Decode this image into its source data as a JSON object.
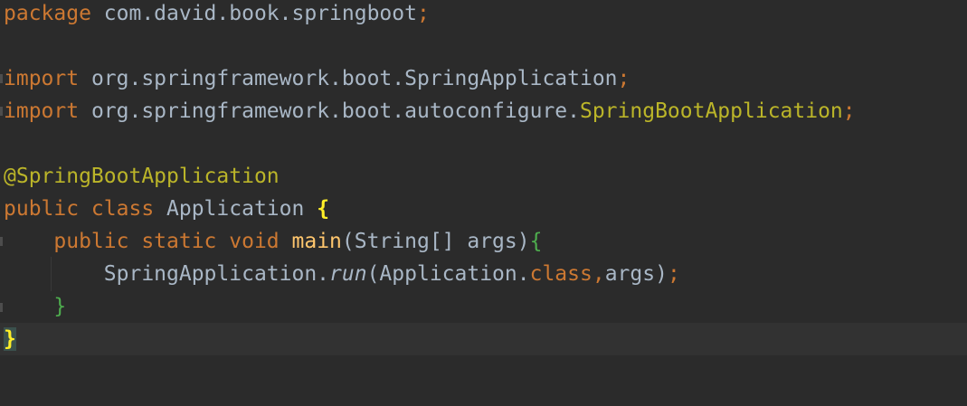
{
  "editor": {
    "colors": {
      "background": "#2b2b2b",
      "current_line": "#323232",
      "keyword": "#cc7832",
      "annotation": "#bbb529",
      "method": "#ffc66d",
      "plain": "#a9b7c6",
      "brace_match": "#ffef28"
    },
    "lines": [
      {
        "tokens": [
          {
            "text": "package",
            "type": "keyword"
          },
          {
            "text": " com.david.book.springboot",
            "type": "plain"
          },
          {
            "text": ";",
            "type": "keyword"
          }
        ]
      },
      {
        "tokens": []
      },
      {
        "tokens": [
          {
            "text": "import",
            "type": "keyword"
          },
          {
            "text": " org.springframework.boot.SpringApplication",
            "type": "plain"
          },
          {
            "text": ";",
            "type": "keyword"
          }
        ]
      },
      {
        "tokens": [
          {
            "text": "import",
            "type": "keyword"
          },
          {
            "text": " org.springframework.boot.autoconfigure.",
            "type": "plain"
          },
          {
            "text": "SpringBootApplication",
            "type": "annotation"
          },
          {
            "text": ";",
            "type": "keyword"
          }
        ]
      },
      {
        "tokens": []
      },
      {
        "tokens": [
          {
            "text": "@SpringBootApplication",
            "type": "annotation"
          }
        ]
      },
      {
        "tokens": [
          {
            "text": "public class",
            "type": "keyword"
          },
          {
            "text": " Application ",
            "type": "plain"
          },
          {
            "text": "{",
            "type": "brace-hl"
          }
        ]
      },
      {
        "tokens": [
          {
            "text": "    public static void",
            "type": "keyword"
          },
          {
            "text": " ",
            "type": "plain"
          },
          {
            "text": "main",
            "type": "method"
          },
          {
            "text": "(String[] args)",
            "type": "plain"
          },
          {
            "text": "{",
            "type": "brace-green"
          }
        ]
      },
      {
        "tokens": [
          {
            "text": "        SpringApplication.",
            "type": "plain"
          },
          {
            "text": "run",
            "type": "static-call"
          },
          {
            "text": "(Application.",
            "type": "plain"
          },
          {
            "text": "class",
            "type": "keyword"
          },
          {
            "text": ",",
            "type": "keyword"
          },
          {
            "text": "args)",
            "type": "plain"
          },
          {
            "text": ";",
            "type": "keyword"
          }
        ]
      },
      {
        "tokens": [
          {
            "text": "    ",
            "type": "plain"
          },
          {
            "text": "}",
            "type": "brace-green"
          }
        ]
      },
      {
        "current": true,
        "tokens": [
          {
            "text": "}",
            "type": "brace-hl-bg"
          }
        ]
      }
    ]
  }
}
